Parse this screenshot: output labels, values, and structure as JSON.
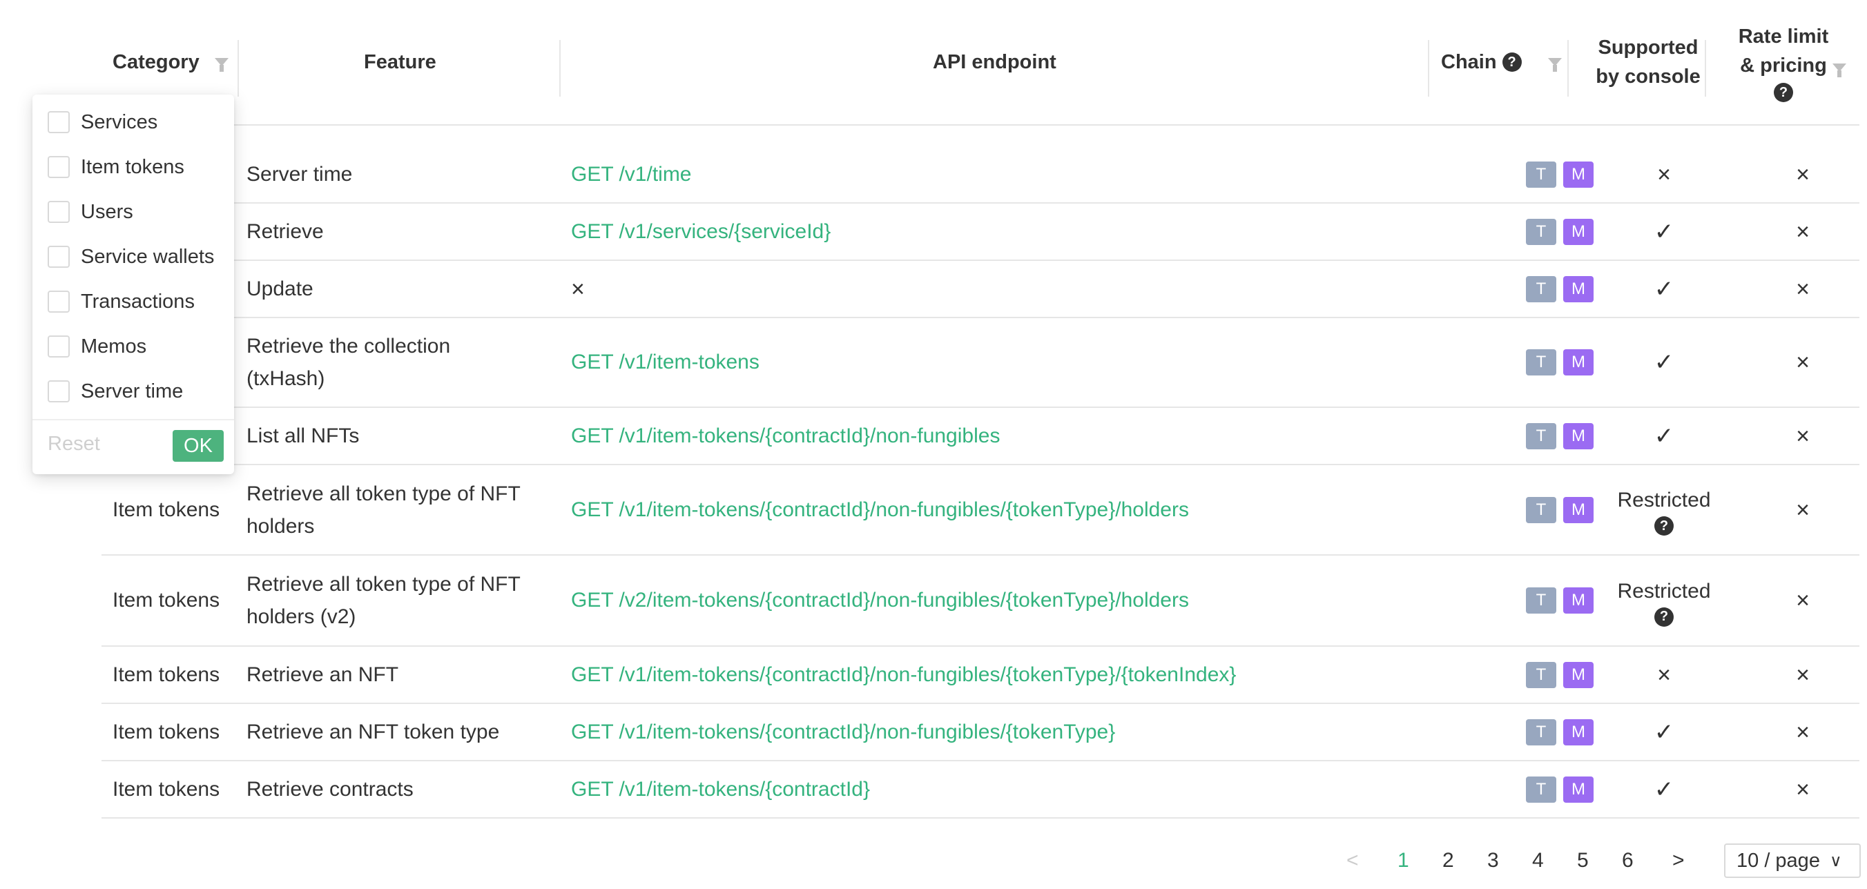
{
  "columns": {
    "category": "Category",
    "feature": "Feature",
    "api": "API endpoint",
    "chain": "Chain",
    "console_line1": "Supported",
    "console_line2": "by console",
    "rate_line1": "Rate limit",
    "rate_line2": "& pricing"
  },
  "rows": [
    {
      "category": "",
      "feature": "Server time",
      "api": "GET /v1/time",
      "console": "×",
      "rate": "×"
    },
    {
      "category": "",
      "feature": "Retrieve",
      "api": "GET /v1/services/{serviceId}",
      "console": "✓",
      "rate": "×"
    },
    {
      "category": "",
      "feature": "Update",
      "api": "×",
      "console": "✓",
      "rate": "×"
    },
    {
      "category": "",
      "feature_line1": "Retrieve the collection",
      "feature_line2": "(txHash)",
      "api": "GET /v1/item-tokens",
      "console": "✓",
      "rate": "×"
    },
    {
      "category": "",
      "feature": "List all NFTs",
      "api": "GET /v1/item-tokens/{contractId}/non-fungibles",
      "console": "✓",
      "rate": "×"
    },
    {
      "category": "Item tokens",
      "feature_line1": "Retrieve all token type of NFT",
      "feature_line2": "holders",
      "api": "GET /v1/item-tokens/{contractId}/non-fungibles/{tokenType}/holders",
      "console": "Restricted",
      "rate": "×"
    },
    {
      "category": "Item tokens",
      "feature_line1": "Retrieve all token type of NFT",
      "feature_line2": "holders (v2)",
      "api": "GET /v2/item-tokens/{contractId}/non-fungibles/{tokenType}/holders",
      "console": "Restricted",
      "rate": "×"
    },
    {
      "category": "Item tokens",
      "feature": "Retrieve an NFT",
      "api": "GET /v1/item-tokens/{contractId}/non-fungibles/{tokenType}/{tokenIndex}",
      "console": "×",
      "rate": "×"
    },
    {
      "category": "Item tokens",
      "feature": "Retrieve an NFT token type",
      "api": "GET /v1/item-tokens/{contractId}/non-fungibles/{tokenType}",
      "console": "✓",
      "rate": "×"
    },
    {
      "category": "Item tokens",
      "feature": "Retrieve contracts",
      "api": "GET /v1/item-tokens/{contractId}",
      "console": "✓",
      "rate": "×"
    }
  ],
  "chain_badges": {
    "t": "T",
    "m": "M"
  },
  "help_glyph": "?",
  "filter_dropdown": {
    "options": [
      "Services",
      "Item tokens",
      "Users",
      "Service wallets",
      "Transactions",
      "Memos",
      "Server time"
    ],
    "reset_label": "Reset",
    "ok_label": "OK"
  },
  "pagination": {
    "prev": "<",
    "pages": [
      "1",
      "2",
      "3",
      "4",
      "5",
      "6"
    ],
    "current": "1",
    "next": ">",
    "page_size": "10 / page",
    "page_size_arrow": "∨"
  },
  "colors": {
    "link": "#34b37e",
    "accent_green": "#4db37e",
    "badge_t": "#98a7bf",
    "badge_m": "#9b6bf2"
  }
}
